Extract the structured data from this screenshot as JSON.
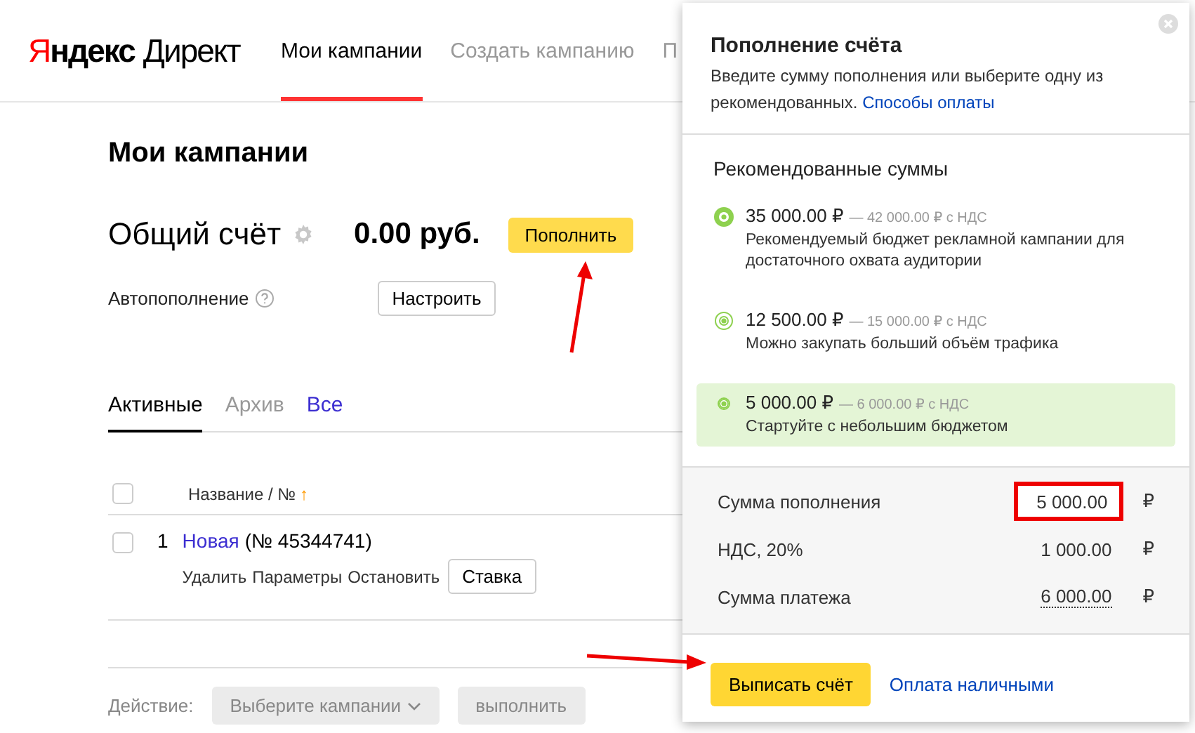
{
  "header": {
    "logo_red": "Я",
    "logo_rest": "ндекс",
    "logo_product": "Директ",
    "nav": [
      {
        "label": "Мои кампании",
        "selected": true
      },
      {
        "label": "Создать кампанию",
        "selected": false
      },
      {
        "label": "П",
        "selected": false
      }
    ]
  },
  "page_title": "Мои кампании",
  "account": {
    "label": "Общий счёт",
    "balance": "0.00 руб.",
    "topup_button": "Пополнить",
    "autopay_label": "Автопополнение",
    "autopay_button": "Настроить"
  },
  "tabs": [
    {
      "label": "Активные",
      "selected": true
    },
    {
      "label": "Архив",
      "selected": false
    },
    {
      "label": "Все",
      "selected": false
    }
  ],
  "table": {
    "all_checked": false,
    "header": "Название / №",
    "sort_mark": "↑",
    "rows": [
      {
        "checked": false,
        "index": "1",
        "name": "Новая",
        "number": "(№ 45344741)",
        "actions": [
          "Удалить",
          "Параметры",
          "Остановить"
        ],
        "bid_button": "Ставка"
      }
    ]
  },
  "action_bar": {
    "label": "Действие:",
    "select": "Выберите кампании",
    "button": "выполнить"
  },
  "popup": {
    "title": "Пополнение счёта",
    "description": "Введите сумму пополнения или выберите одну из рекомендованных.",
    "payment_link": "Способы оплаты",
    "section_title": "Рекомендованные суммы",
    "options": [
      {
        "amount": "35 000.00 ₽",
        "vat": "— 42 000.00 ₽ с НДС",
        "description": "Рекомендуемый бюджет рекламной кампании для достаточного охвата аудитории",
        "selected": false
      },
      {
        "amount": "12 500.00 ₽",
        "vat": "— 15 000.00 ₽ с НДС",
        "description": "Можно закупать больший объём трафика",
        "selected": false
      },
      {
        "amount": "5 000.00 ₽",
        "vat": "— 6 000.00 ₽ с НДС",
        "description": "Стартуйте с небольшим бюджетом",
        "selected": true
      }
    ],
    "summary": [
      {
        "kind": "input",
        "label": "Сумма пополнения",
        "value": "5 000.00",
        "currency": "₽"
      },
      {
        "kind": "text",
        "label": "НДС, 20%",
        "value": "1 000.00",
        "currency": "₽"
      },
      {
        "kind": "dotted",
        "label": "Сумма платежа",
        "value": "6 000.00",
        "currency": "₽"
      }
    ],
    "invoice_button": "Выписать счёт",
    "cash_link": "Оплата наличными"
  }
}
